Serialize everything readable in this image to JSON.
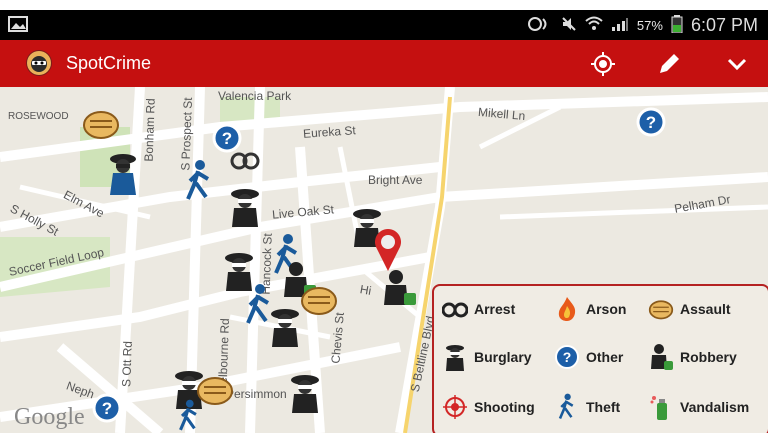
{
  "status": {
    "battery": "57%",
    "time": "6:07 PM"
  },
  "app": {
    "title": "SpotCrime"
  },
  "map": {
    "labels": [
      {
        "text": "ROSEWOOD"
      },
      {
        "text": "Valencia Park"
      },
      {
        "text": "Mikell Ln"
      },
      {
        "text": "Eureka St"
      },
      {
        "text": "Bright Ave"
      },
      {
        "text": "Live Oak St"
      },
      {
        "text": "Elm Ave"
      },
      {
        "text": "S Holly St"
      },
      {
        "text": "Soccer Field Loop"
      },
      {
        "text": "Pelham Dr"
      },
      {
        "text": "S Prospect St"
      },
      {
        "text": "Bonham Rd"
      },
      {
        "text": "Hancock St"
      },
      {
        "text": "S Ott Rd"
      },
      {
        "text": "Melbourne Rd"
      },
      {
        "text": "Chevis St"
      },
      {
        "text": "Persimmon"
      },
      {
        "text": "S Beltline Blvd"
      },
      {
        "text": "Neph"
      },
      {
        "text": "Hi"
      }
    ],
    "attribution": "Google"
  },
  "legend": {
    "items": [
      {
        "label": "Arrest",
        "icon": "handcuffs-icon"
      },
      {
        "label": "Arson",
        "icon": "fire-icon"
      },
      {
        "label": "Assault",
        "icon": "fist-icon"
      },
      {
        "label": "Burglary",
        "icon": "burglar-icon"
      },
      {
        "label": "Other",
        "icon": "question-icon"
      },
      {
        "label": "Robbery",
        "icon": "robber-icon"
      },
      {
        "label": "Shooting",
        "icon": "crosshair-icon"
      },
      {
        "label": "Theft",
        "icon": "running-thief-icon"
      },
      {
        "label": "Vandalism",
        "icon": "spraycan-icon"
      }
    ]
  },
  "colors": {
    "appbar": "#c51010",
    "status": "#000000",
    "legendBorder": "#b52222"
  }
}
